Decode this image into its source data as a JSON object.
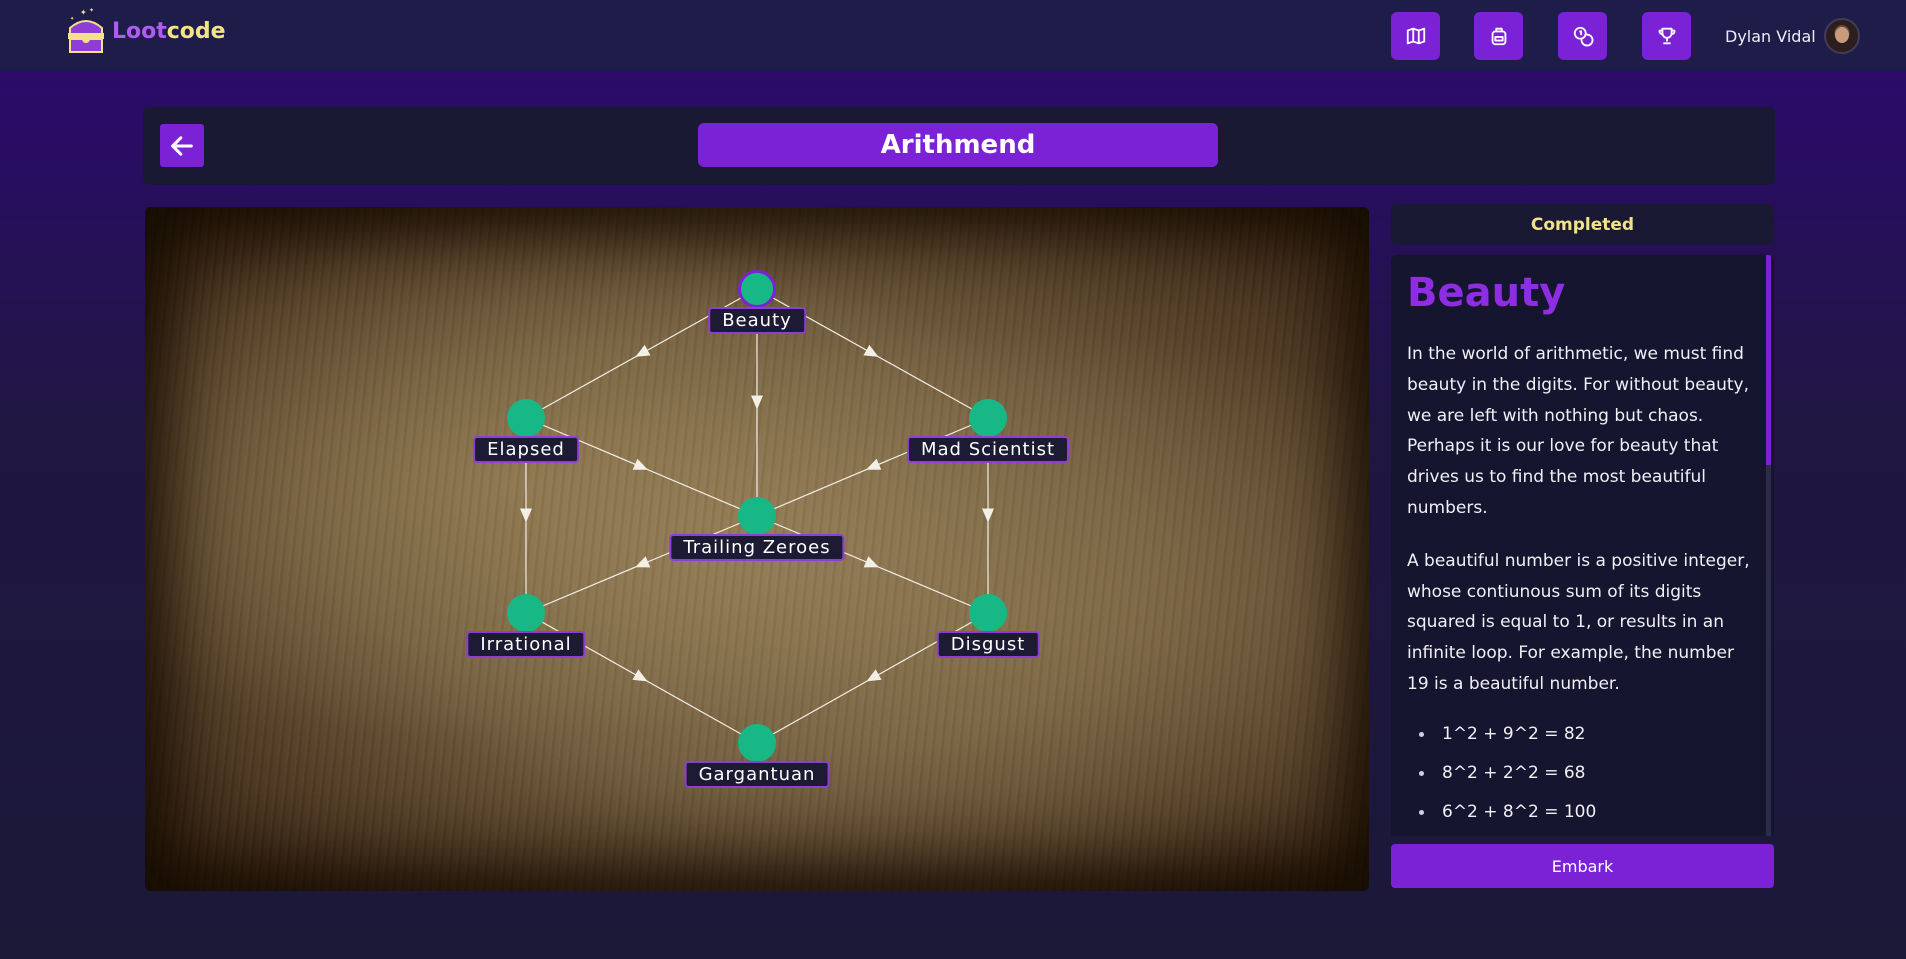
{
  "nav": {
    "logo_part1": "Loot",
    "logo_part2": "code",
    "buttons": [
      {
        "icon": "map-icon"
      },
      {
        "icon": "backpack-icon"
      },
      {
        "icon": "coins-icon"
      },
      {
        "icon": "trophy-icon"
      }
    ],
    "user_name": "Dylan Vidal"
  },
  "header": {
    "title": "Arithmend",
    "back_icon": "arrow-left-icon"
  },
  "map": {
    "nodes": [
      {
        "id": "beauty",
        "label": "Beauty",
        "active": true
      },
      {
        "id": "elapsed",
        "label": "Elapsed",
        "active": false
      },
      {
        "id": "mad-scientist",
        "label": "Mad Scientist",
        "active": false
      },
      {
        "id": "trailing-zeroes",
        "label": "Trailing Zeroes",
        "active": false
      },
      {
        "id": "irrational",
        "label": "Irrational",
        "active": false
      },
      {
        "id": "disgust",
        "label": "Disgust",
        "active": false
      },
      {
        "id": "gargantuan",
        "label": "Gargantuan",
        "active": false
      }
    ],
    "edges": [
      [
        "beauty",
        "elapsed"
      ],
      [
        "beauty",
        "trailing-zeroes"
      ],
      [
        "beauty",
        "mad-scientist"
      ],
      [
        "elapsed",
        "trailing-zeroes"
      ],
      [
        "mad-scientist",
        "trailing-zeroes"
      ],
      [
        "elapsed",
        "irrational"
      ],
      [
        "mad-scientist",
        "disgust"
      ],
      [
        "trailing-zeroes",
        "irrational"
      ],
      [
        "trailing-zeroes",
        "disgust"
      ],
      [
        "irrational",
        "gargantuan"
      ],
      [
        "disgust",
        "gargantuan"
      ]
    ]
  },
  "status": "Completed",
  "panel": {
    "title": "Beauty",
    "paragraph1": "In the world of arithmetic, we must find beauty in the digits. For without beauty, we are left with nothing but chaos. Perhaps it is our love for beauty that drives us to find the most beautiful numbers.",
    "paragraph2": "A beautiful number is a positive integer, whose contiunous sum of its digits squared is equal to 1, or results in an infinite loop. For example, the number 19 is a beautiful number.",
    "examples": [
      "1^2 + 9^2 = 82",
      "8^2 + 2^2 = 68",
      "6^2 + 8^2 = 100"
    ]
  },
  "embark_label": "Embark",
  "colors": {
    "accent": "#7b22d6",
    "node": "#17b886",
    "status_text": "#f3e28a",
    "title_text": "#8e2de2"
  }
}
